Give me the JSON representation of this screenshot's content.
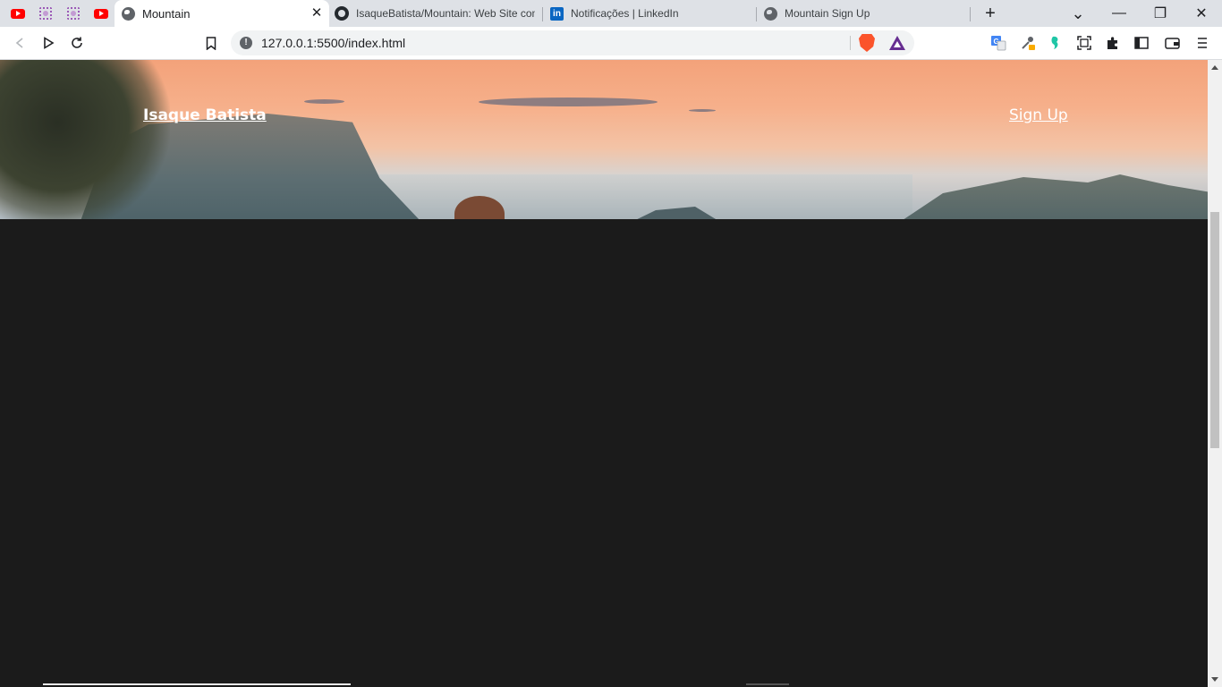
{
  "browser": {
    "pinned_tabs": [
      {
        "icon": "youtube-icon"
      },
      {
        "icon": "extension-gear-icon"
      },
      {
        "icon": "extension-gear-icon"
      },
      {
        "icon": "youtube-icon"
      }
    ],
    "tabs": [
      {
        "title": "Mountain",
        "icon": "globe-icon",
        "active": true
      },
      {
        "title": "IsaqueBatista/Mountain: Web Site com",
        "icon": "github-icon",
        "active": false
      },
      {
        "title": "Notificações | LinkedIn",
        "icon": "linkedin-icon",
        "active": false
      },
      {
        "title": "Mountain Sign Up",
        "icon": "globe-icon",
        "active": false
      }
    ],
    "new_tab_symbol": "+",
    "tab_search_symbol": "⌄",
    "window_controls": {
      "minimize": "—",
      "restore": "❐",
      "close": "✕"
    },
    "close_tab_symbol": "✕",
    "address": "127.0.0.1:5500/index.html",
    "colors": {
      "brave_lion": "#fb542b",
      "bat_rewards": "#662d91",
      "tab_strip": "#dee1e6"
    }
  },
  "page": {
    "nav": {
      "brand": "Isaque Batista",
      "signup": "Sign Up"
    },
    "colors": {
      "body_bg": "#1b1b1b",
      "nav_text": "#ffffff"
    }
  }
}
